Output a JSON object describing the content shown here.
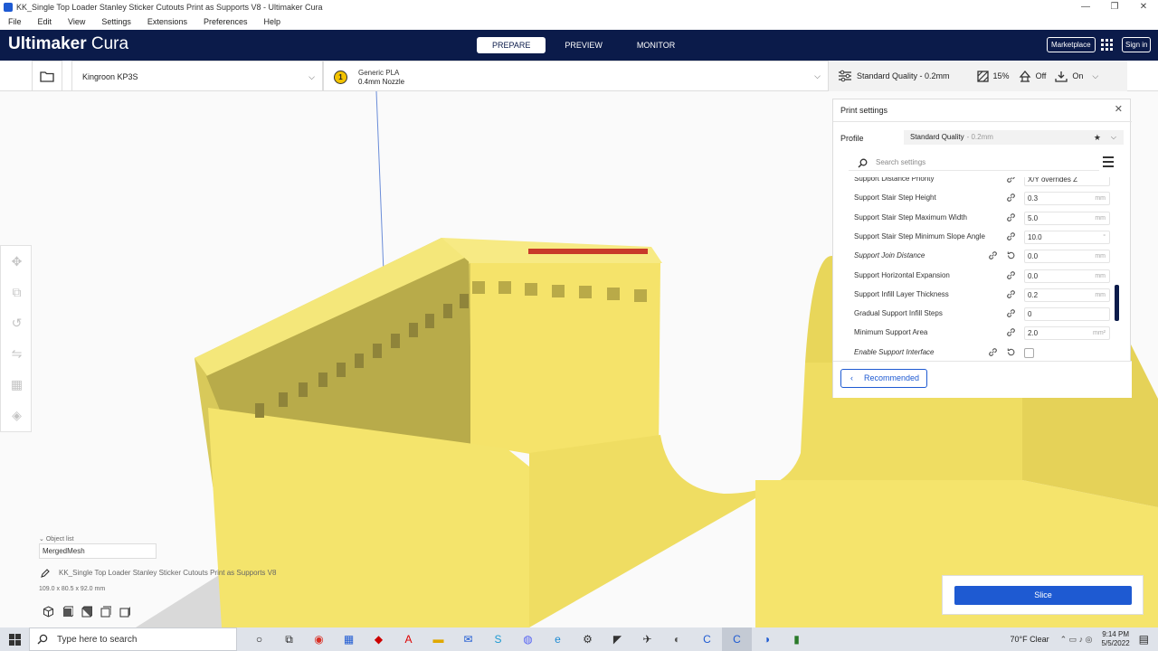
{
  "window": {
    "title": "KK_Single Top Loader Stanley Sticker Cutouts Print as Supports V8 - Ultimaker Cura",
    "minimize": "—",
    "maximize": "❐",
    "close": "✕"
  },
  "menu": [
    "File",
    "Edit",
    "View",
    "Settings",
    "Extensions",
    "Preferences",
    "Help"
  ],
  "header": {
    "brand_bold": "Ultimaker",
    "brand_light": " Cura",
    "stages": [
      "PREPARE",
      "PREVIEW",
      "MONITOR"
    ],
    "active_stage": "PREPARE",
    "marketplace": "Marketplace",
    "signin": "Sign in"
  },
  "toolbar": {
    "printer": "Kingroon KP3S",
    "extruder_number": "1",
    "material": "Generic PLA",
    "nozzle": "0.4mm Nozzle",
    "quality": "Standard Quality - 0.2mm",
    "infill": "15%",
    "support": "Off",
    "adhesion": "On"
  },
  "print_settings": {
    "title": "Print settings",
    "profile_label": "Profile",
    "profile_value": "Standard Quality",
    "profile_sub": "- 0.2mm",
    "search_placeholder": "Search settings",
    "rows": [
      {
        "label": "Support Distance Priority",
        "value": "X/Y overrides Z",
        "unit": "",
        "italic": false
      },
      {
        "label": "Support Stair Step Height",
        "value": "0.3",
        "unit": "mm",
        "italic": false
      },
      {
        "label": "Support Stair Step Maximum Width",
        "value": "5.0",
        "unit": "mm",
        "italic": false
      },
      {
        "label": "Support Stair Step Minimum Slope Angle",
        "value": "10.0",
        "unit": "°",
        "italic": false
      },
      {
        "label": "Support Join Distance",
        "value": "0.0",
        "unit": "mm",
        "italic": true
      },
      {
        "label": "Support Horizontal Expansion",
        "value": "0.0",
        "unit": "mm",
        "italic": false
      },
      {
        "label": "Support Infill Layer Thickness",
        "value": "0.2",
        "unit": "mm",
        "italic": false
      },
      {
        "label": "Gradual Support Infill Steps",
        "value": "0",
        "unit": "",
        "italic": false
      },
      {
        "label": "Minimum Support Area",
        "value": "2.0",
        "unit": "mm²",
        "italic": false
      },
      {
        "label": "Enable Support Interface",
        "value": "",
        "unit": "",
        "italic": true
      }
    ],
    "recommended": "Recommended"
  },
  "object_list": {
    "header": "Object list",
    "mesh": "MergedMesh",
    "filename": "KK_Single Top Loader Stanley Sticker Cutouts Print as Supports V8",
    "dimensions": "109.0 x 80.5 x 92.0 mm"
  },
  "slice": {
    "label": "Slice"
  },
  "taskbar": {
    "search_placeholder": "Type here to search",
    "weather": "70°F  Clear",
    "time": "9:14 PM",
    "date": "5/5/2022"
  },
  "colors": {
    "header_bg": "#0b1b4a",
    "accent": "#1e5ad2",
    "model": "#f5e66a"
  }
}
